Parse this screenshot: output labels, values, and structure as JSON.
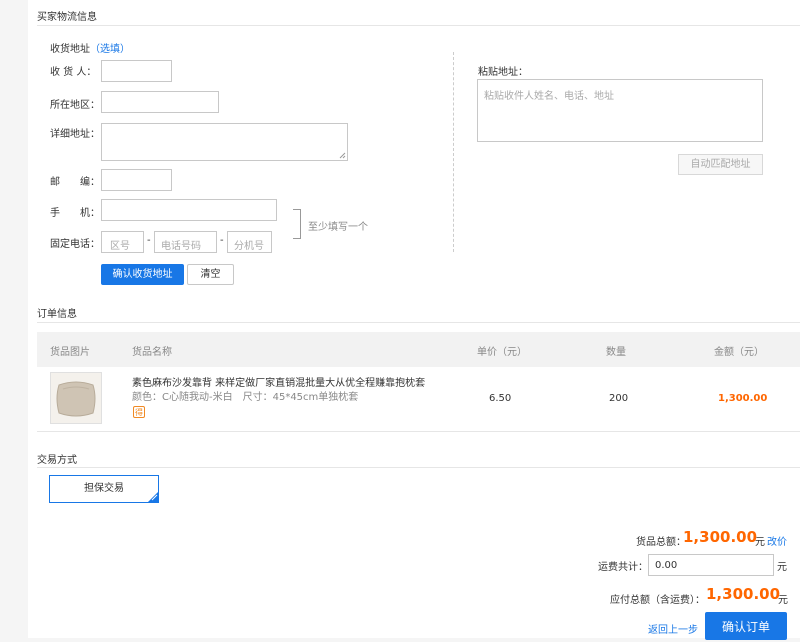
{
  "buyer_section": {
    "title": "买家物流信息"
  },
  "address": {
    "heading": "收货地址",
    "optional": "（选填）",
    "receiver_label": "收 货 人：",
    "region_label": "所在地区：",
    "detail_label": "详细地址：",
    "postcode_label": "邮　　编：",
    "mobile_label": "手　　机：",
    "phone_label": "固定电话：",
    "area_placeholder": "区号",
    "phone_placeholder": "电话号码",
    "ext_placeholder": "分机号",
    "dash": "-",
    "at_least_one": "至少填写一个",
    "confirm_label": "确认收货地址",
    "clear_label": "清空"
  },
  "paste": {
    "label": "粘贴地址：",
    "placeholder": "粘贴收件人姓名、电话、地址",
    "match_label": "自动匹配地址"
  },
  "order_section": {
    "title": "订单信息",
    "headers": {
      "image": "货品图片",
      "name": "货品名称",
      "price": "单价（元）",
      "qty": "数量",
      "amount": "金额（元）"
    },
    "item": {
      "name": "素色麻布沙发靠背 来样定做厂家直销混批量大从优全程赚靠抱枕套",
      "spec": "颜色：C心随我动-米白　尺寸：45*45cm单独枕套",
      "badge": "得",
      "price": "6.50",
      "qty": "200",
      "amount": "1,300.00"
    }
  },
  "trade_section": {
    "title": "交易方式",
    "option": "担保交易"
  },
  "summary": {
    "goods_total_label": "货品总额：",
    "goods_total": "1,300.00",
    "unit": "元",
    "edit_price": "改价",
    "shipping_label": "运费共计：",
    "shipping_value": "0.00",
    "payable_label": "应付总额（含运费）：",
    "payable": "1,300.00",
    "back_label": "返回上一步",
    "confirm_order_label": "确认订单"
  },
  "colors": {
    "accent": "#1877e6",
    "price": "#ff6600"
  }
}
